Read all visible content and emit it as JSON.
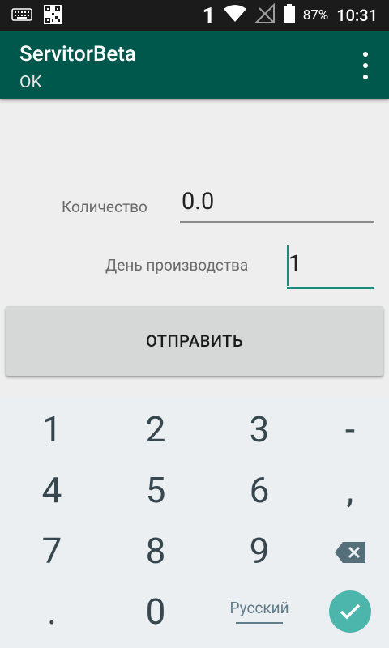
{
  "status_bar": {
    "sim_number": "1",
    "battery_percent": "87%",
    "time": "10:31"
  },
  "app_bar": {
    "title": "ServitorBeta",
    "subtitle": "OK"
  },
  "form": {
    "quantity_label": "Количество",
    "quantity_value": "0.0",
    "production_day_label": "День производства",
    "production_day_value": "1",
    "submit_label": "ОТПРАВИТЬ"
  },
  "keyboard": {
    "rows": [
      [
        "1",
        "2",
        "3",
        "-"
      ],
      [
        "4",
        "5",
        "6",
        ","
      ],
      [
        "7",
        "8",
        "9"
      ],
      [
        ".",
        "0"
      ]
    ],
    "language": "Русский"
  },
  "colors": {
    "app_bar": "#00574b",
    "status_bar": "#1b1b1b",
    "accent": "#1a8a7d",
    "enter_key": "#4db6ac"
  }
}
